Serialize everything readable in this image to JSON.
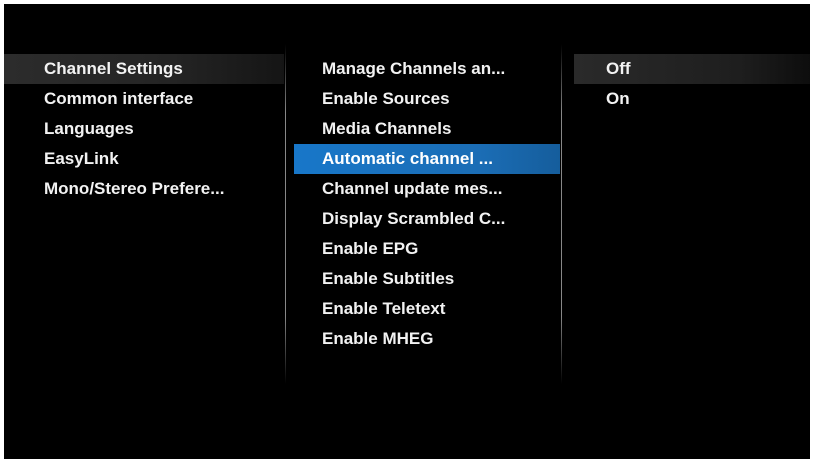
{
  "menu": {
    "left": {
      "items": [
        "Channel Settings",
        "Common interface",
        "Languages",
        "EasyLink",
        "Mono/Stereo Prefere..."
      ],
      "selected_index": 0
    },
    "middle": {
      "items": [
        "Manage Channels an...",
        "Enable Sources",
        "Media Channels",
        "Automatic channel ...",
        "Channel update mes...",
        "Display Scrambled C...",
        "Enable EPG",
        "Enable Subtitles",
        "Enable Teletext",
        "Enable MHEG"
      ],
      "highlighted_index": 3
    },
    "right": {
      "items": [
        "Off",
        "On"
      ],
      "selected_index": 0
    }
  },
  "colors": {
    "background": "#000000",
    "highlight": "#1877c9",
    "text": "#f2f2f2"
  }
}
